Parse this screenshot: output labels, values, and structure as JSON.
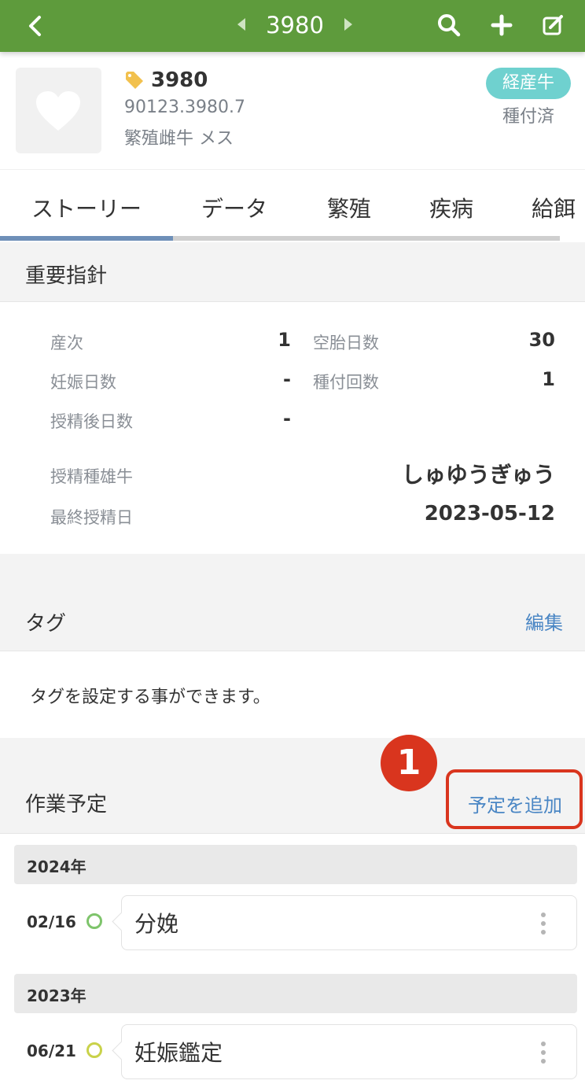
{
  "header": {
    "title": "3980",
    "icons": [
      "back-chevron-icon",
      "prev-triangle-icon",
      "next-triangle-icon",
      "search-icon",
      "plus-icon",
      "edit-icon"
    ],
    "color": "#5e9b3c"
  },
  "animal": {
    "cow_number": "3980",
    "id_code": "90123.3980.7",
    "category": "繁殖雌牛 メス",
    "badge": "経産牛",
    "status": "種付済",
    "badge_color": "#6fd1cf"
  },
  "tabs": [
    "ストーリー",
    "データ",
    "繁殖",
    "疾病",
    "給餌"
  ],
  "important": {
    "title": "重要指針",
    "stats": [
      {
        "label": "産次",
        "value": "1"
      },
      {
        "label": "空胎日数",
        "value": "30"
      },
      {
        "label": "妊娠日数",
        "value": "-"
      },
      {
        "label": "種付回数",
        "value": "1"
      },
      {
        "label": "授精後日数",
        "value": "-"
      }
    ],
    "sire_label": "授精種雄牛",
    "sire_value": "しゅゆうぎゅう",
    "last_label": "最終授精日",
    "last_value": "2023-05-12"
  },
  "tag": {
    "title": "タグ",
    "edit": "編集",
    "placeholder": "タグを設定する事ができます。"
  },
  "schedule": {
    "title": "作業予定",
    "add": "予定を追加",
    "marker": "1",
    "groups": [
      {
        "year": "2024年",
        "items": [
          {
            "date": "02/16",
            "name": "分娩"
          }
        ]
      },
      {
        "year": "2023年",
        "items": [
          {
            "date": "06/21",
            "name": "妊娠鑑定"
          }
        ]
      }
    ],
    "highlight_color": "#d9351e",
    "link_color": "#4a86c4"
  }
}
